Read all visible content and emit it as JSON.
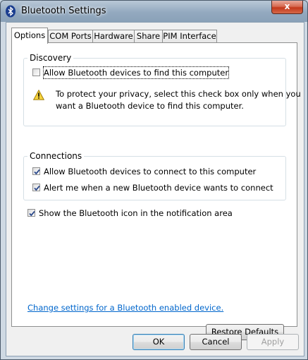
{
  "window": {
    "title": "Bluetooth Settings",
    "close_label": "x"
  },
  "tabs": [
    {
      "label": "Options",
      "active": true
    },
    {
      "label": "COM Ports",
      "active": false
    },
    {
      "label": "Hardware",
      "active": false
    },
    {
      "label": "Share",
      "active": false
    },
    {
      "label": "PIM Interface",
      "active": false
    }
  ],
  "discovery": {
    "title": "Discovery",
    "allow_find": {
      "label": "Allow Bluetooth devices to find this computer",
      "checked": false
    },
    "warning_icon": "warning-icon",
    "warning_text": "To protect your privacy, select this check box only when you want a Bluetooth device to find this computer."
  },
  "connections": {
    "title": "Connections",
    "allow_connect": {
      "label": "Allow Bluetooth devices to connect to this computer",
      "checked": true
    },
    "alert_connect": {
      "label": "Alert me when a new Bluetooth device wants to connect",
      "checked": true
    }
  },
  "show_icon": {
    "label": "Show the Bluetooth icon in the notification area",
    "checked": true
  },
  "link_text": "Change settings for a Bluetooth enabled device.",
  "buttons": {
    "restore": "Restore Defaults",
    "ok": "OK",
    "cancel": "Cancel",
    "apply": "Apply"
  }
}
